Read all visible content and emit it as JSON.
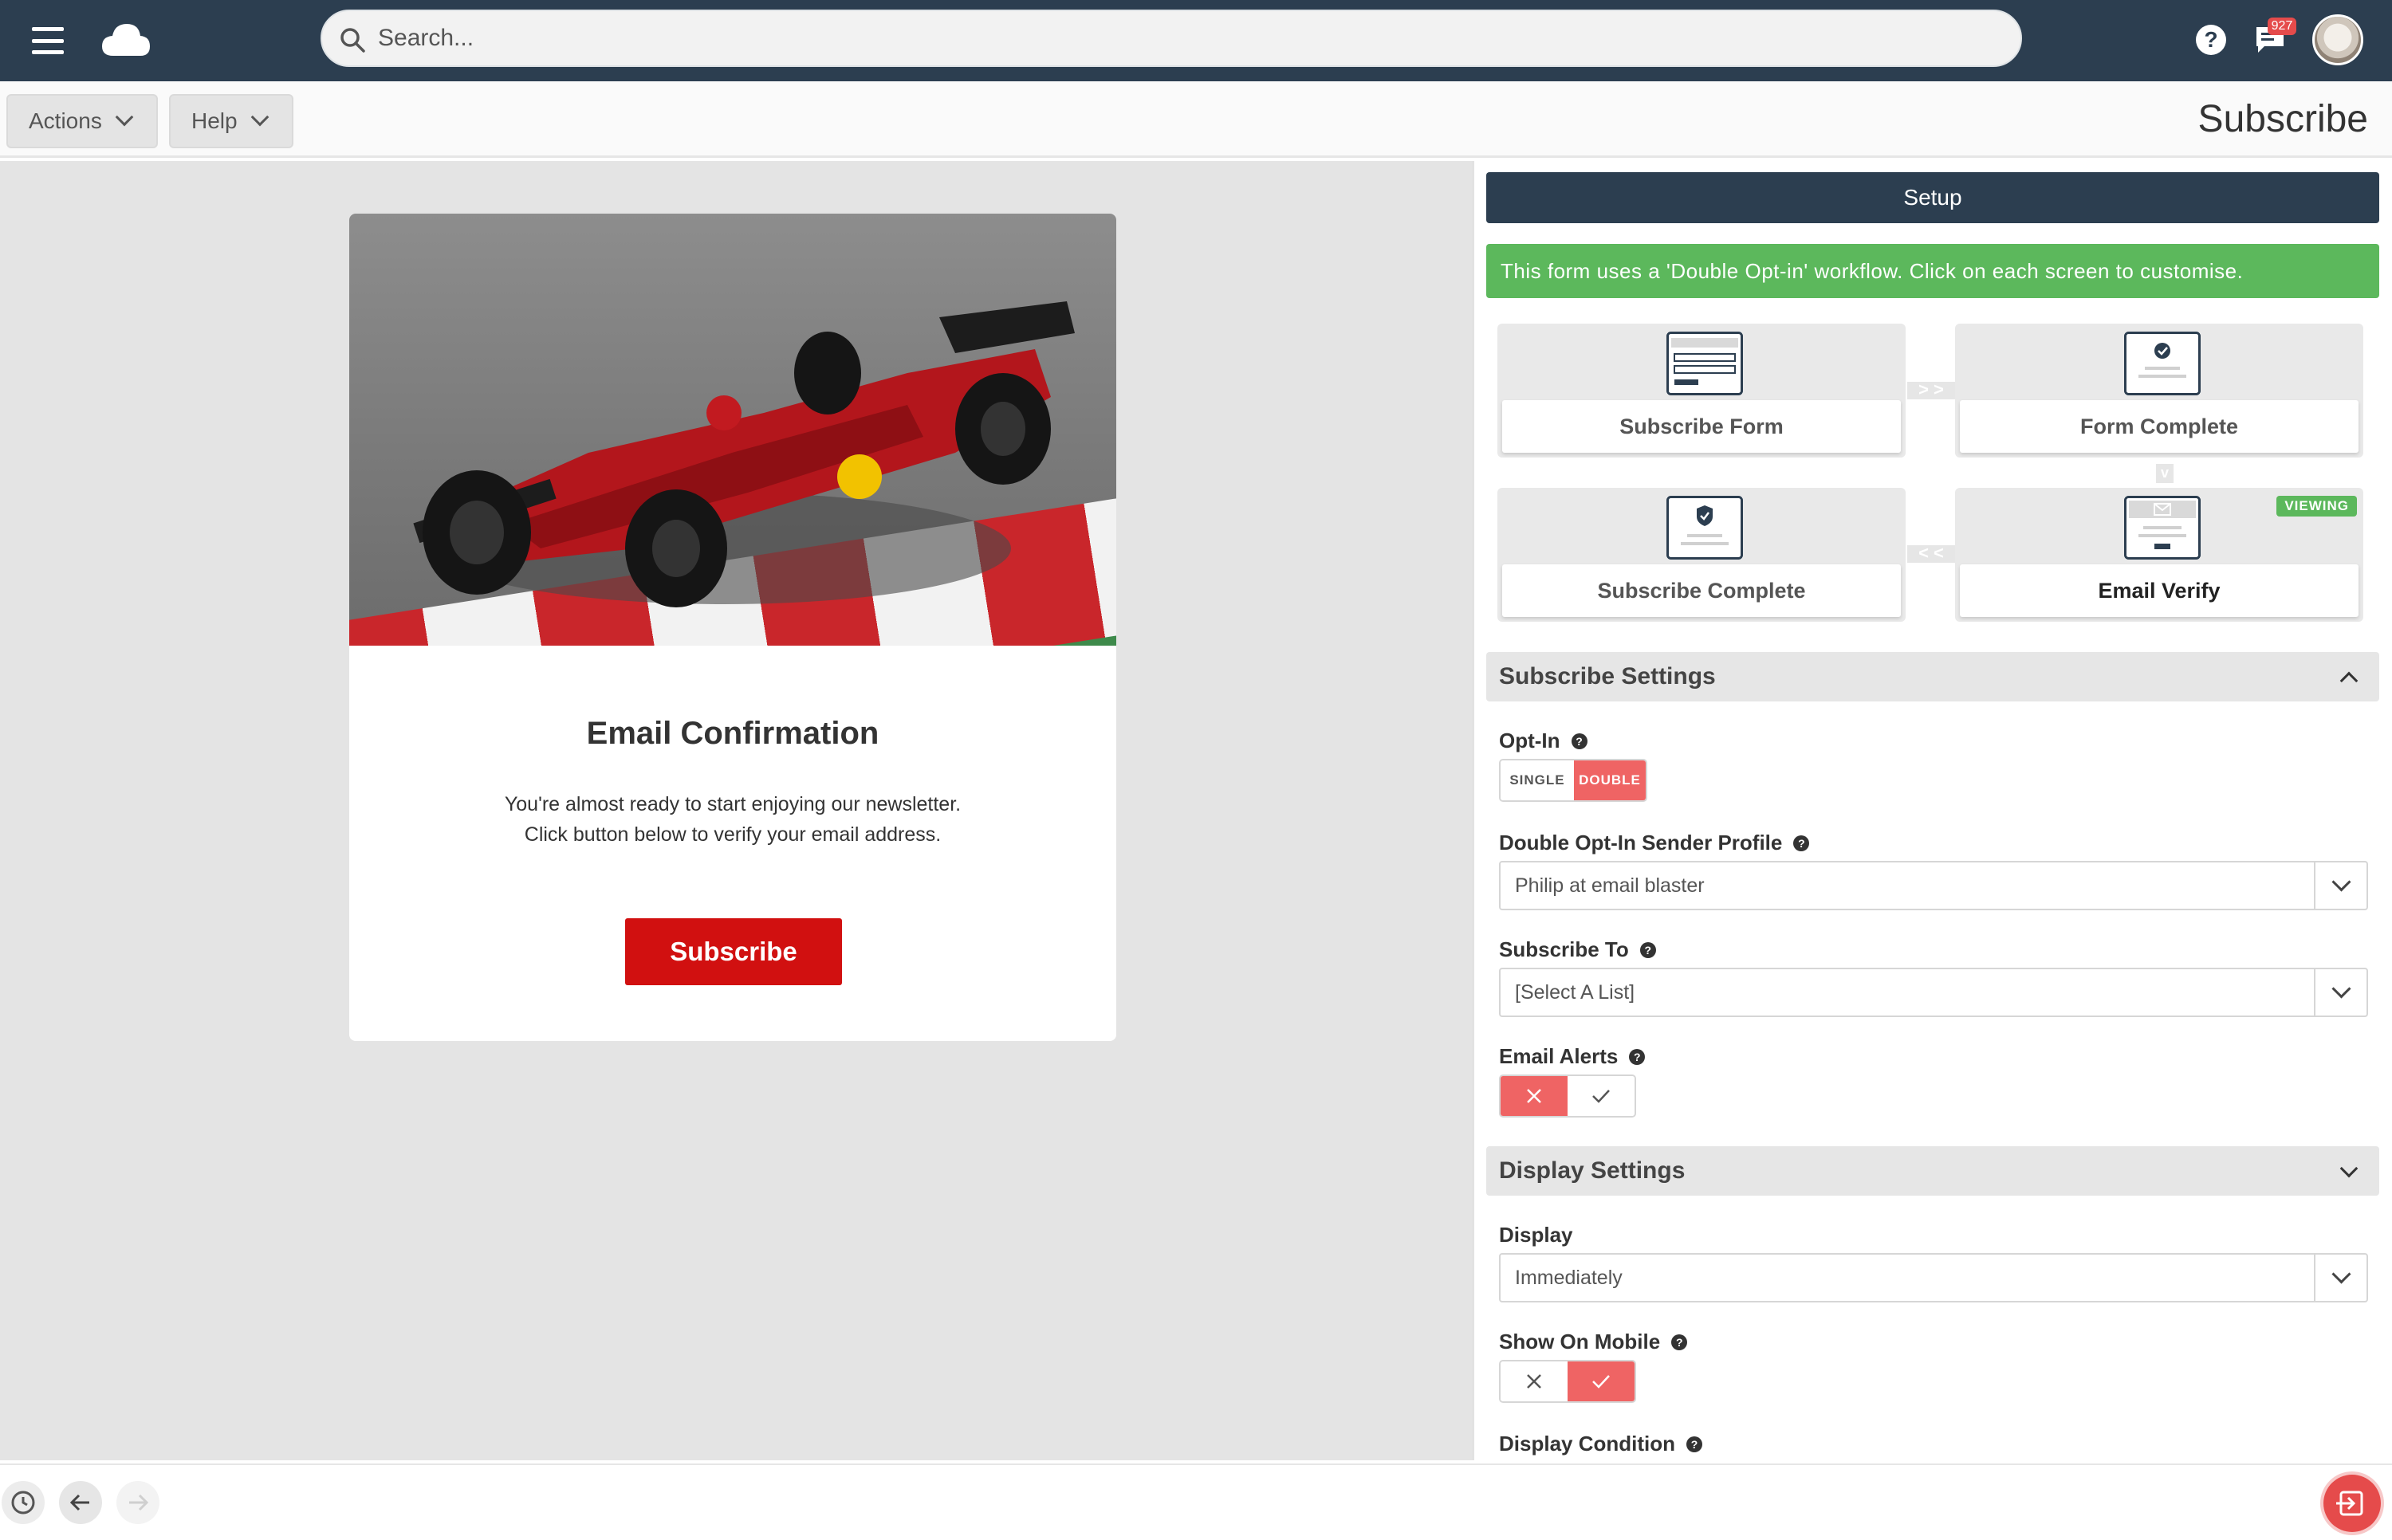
{
  "topbar": {
    "search_placeholder": "Search...",
    "notification_count": "927",
    "icons": [
      "menu-icon",
      "cloud-icon",
      "search-icon",
      "help-icon",
      "chat-icon",
      "avatar"
    ]
  },
  "toolbar": {
    "actions_label": "Actions",
    "help_label": "Help",
    "page_title": "Subscribe"
  },
  "preview": {
    "title": "Email Confirmation",
    "body_line1": "You're almost ready to start enjoying our newsletter.",
    "body_line2": "Click button below to verify your email address.",
    "button_label": "Subscribe"
  },
  "panel": {
    "setup_label": "Setup",
    "alert_text": "This form uses a 'Double Opt-in' workflow. Click on each screen to customise.",
    "workflow": [
      {
        "label": "Subscribe Form",
        "viewing": false
      },
      {
        "label": "Form Complete",
        "viewing": false
      },
      {
        "label": "Subscribe Complete",
        "viewing": false
      },
      {
        "label": "Email Verify",
        "viewing": true
      }
    ],
    "viewing_badge": "VIEWING",
    "subscribe_settings": {
      "header": "Subscribe Settings",
      "optin_label": "Opt-In",
      "optin_single": "SINGLE",
      "optin_double": "DOUBLE",
      "optin_selected": "DOUBLE",
      "sender_label": "Double Opt-In Sender Profile",
      "sender_value": "Philip at email blaster",
      "subscribe_to_label": "Subscribe To",
      "subscribe_to_value": "[Select A List]",
      "email_alerts_label": "Email Alerts",
      "email_alerts_on": false
    },
    "display_settings": {
      "header": "Display Settings",
      "display_label": "Display",
      "display_value": "Immediately",
      "mobile_label": "Show On Mobile",
      "mobile_on": true,
      "condition_label": "Display Condition"
    }
  },
  "colors": {
    "navy": "#2c3e50",
    "green": "#5cb85c",
    "toggle_on": "#ef6464",
    "cta_red": "#d11010"
  }
}
